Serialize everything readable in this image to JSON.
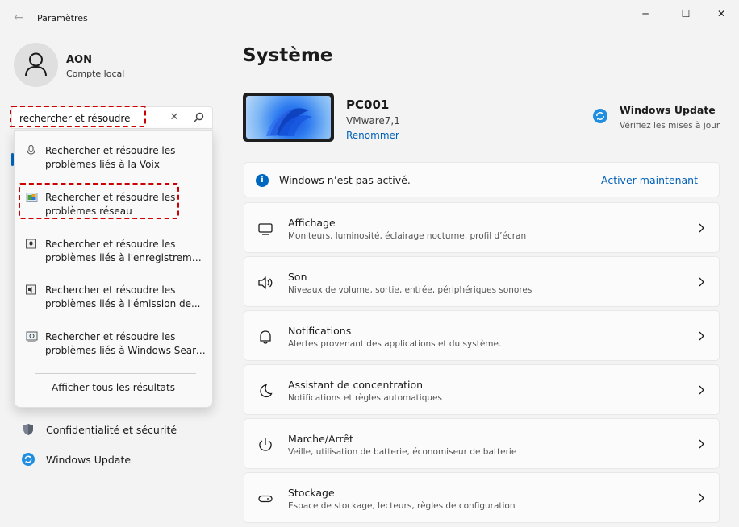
{
  "window": {
    "title": "Paramètres",
    "back_glyph": "←",
    "minimize_glyph": "─",
    "maximize_glyph": "☐",
    "close_glyph": "✕"
  },
  "profile": {
    "name": "AON",
    "account_type": "Compte local"
  },
  "search": {
    "value": "rechercher et résoudre",
    "clear_glyph": "✕"
  },
  "search_results": [
    {
      "line1": "Rechercher et résoudre les",
      "line2": "problèmes liés à la Voix",
      "icon": "microphone-icon"
    },
    {
      "line1": "Rechercher et résoudre les",
      "line2": "problèmes réseau",
      "icon": "network-troubleshoot-icon"
    },
    {
      "line1": "Rechercher et résoudre les",
      "line2": "problèmes liés à l'enregistremen...",
      "icon": "recording-troubleshoot-icon"
    },
    {
      "line1": "Rechercher et résoudre les",
      "line2": "problèmes liés à l'émission de...",
      "icon": "audio-output-troubleshoot-icon"
    },
    {
      "line1": "Rechercher et résoudre les",
      "line2": "problèmes liés à Windows Search",
      "icon": "search-troubleshoot-icon"
    }
  ],
  "show_all_results": "Afficher tous les résultats",
  "nav": [
    {
      "label": "Confidentialité et sécurité",
      "icon": "shield-icon"
    },
    {
      "label": "Windows Update",
      "icon": "windows-update-icon"
    }
  ],
  "main": {
    "title": "Système",
    "device": {
      "name": "PC001",
      "model": "VMware7,1",
      "rename": "Renommer"
    },
    "update": {
      "title": "Windows Update",
      "subtitle": "Vérifiez les mises à jour"
    },
    "activation": {
      "message": "Windows n’est pas activé.",
      "action": "Activer maintenant"
    },
    "cards": [
      {
        "title": "Affichage",
        "subtitle": "Moniteurs, luminosité, éclairage nocturne, profil d’écran",
        "icon": "display-icon"
      },
      {
        "title": "Son",
        "subtitle": "Niveaux de volume, sortie, entrée, périphériques sonores",
        "icon": "speaker-icon"
      },
      {
        "title": "Notifications",
        "subtitle": "Alertes provenant des applications et du système.",
        "icon": "bell-icon"
      },
      {
        "title": "Assistant de concentration",
        "subtitle": "Notifications et règles automatiques",
        "icon": "moon-icon"
      },
      {
        "title": "Marche/Arrêt",
        "subtitle": "Veille, utilisation de batterie, économiseur de batterie",
        "icon": "power-icon"
      },
      {
        "title": "Stockage",
        "subtitle": "Espace de stockage, lecteurs, règles de configuration",
        "icon": "storage-icon"
      }
    ]
  },
  "colors": {
    "accent": "#0067c0",
    "link": "#0060b8",
    "highlight_box": "#cc0000",
    "background": "#f3f3f3"
  }
}
